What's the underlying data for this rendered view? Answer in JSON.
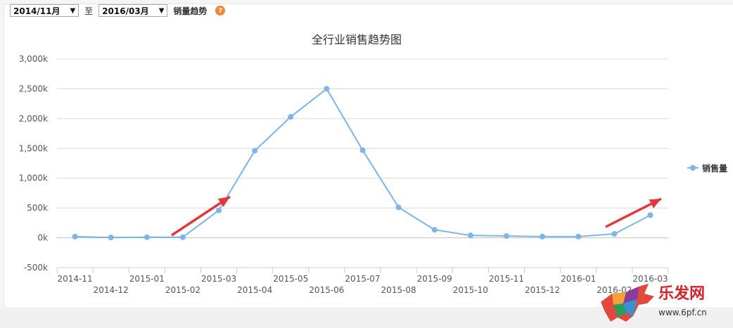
{
  "toolbar": {
    "start_value": "2014/11月",
    "to_label": "至",
    "end_value": "2016/03月",
    "trend_label": "销量趋势",
    "help_glyph": "?"
  },
  "colors": {
    "series": "#7cb5ec",
    "arrow": "#e5363b",
    "help": "#f0883a"
  },
  "chart_data": {
    "type": "line",
    "title": "全行业销售趋势图",
    "xlabel": "",
    "ylabel": "",
    "ylim": [
      -500,
      3000
    ],
    "yticks": [
      "-500k",
      "0k",
      "500k",
      "1,000k",
      "1,500k",
      "2,000k",
      "2,500k",
      "3,000k"
    ],
    "ytick_values": [
      -500,
      0,
      500,
      1000,
      1500,
      2000,
      2500,
      3000
    ],
    "grid": true,
    "legend": "right",
    "categories": [
      "2014-11",
      "2014-12",
      "2015-01",
      "2015-02",
      "2015-03",
      "2015-04",
      "2015-05",
      "2015-06",
      "2015-07",
      "2015-08",
      "2015-09",
      "2015-10",
      "2015-11",
      "2015-12",
      "2016-01",
      "2016-02",
      "2016-03"
    ],
    "series": [
      {
        "name": "销售量",
        "values": [
          20,
          5,
          10,
          10,
          460,
          1460,
          2030,
          2500,
          1470,
          510,
          135,
          40,
          30,
          20,
          20,
          65,
          380
        ]
      }
    ]
  },
  "watermark": {
    "text": "乐发网",
    "url": "www.6pf.cn"
  }
}
